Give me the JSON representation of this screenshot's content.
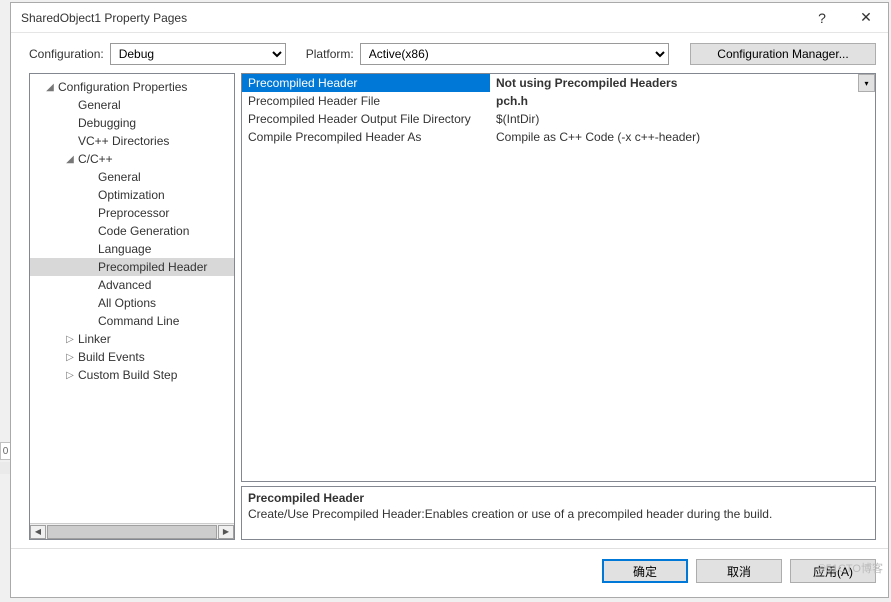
{
  "title": "SharedObject1 Property Pages",
  "toolbar": {
    "config_label": "Configuration:",
    "config_value": "Debug",
    "platform_label": "Platform:",
    "platform_value": "Active(x86)",
    "config_mgr": "Configuration Manager..."
  },
  "tree": {
    "root": "Configuration Properties",
    "items_d1_top": [
      "General",
      "Debugging",
      "VC++ Directories"
    ],
    "cxx": "C/C++",
    "items_d2": [
      "General",
      "Optimization",
      "Preprocessor",
      "Code Generation",
      "Language",
      "Precompiled Header",
      "Advanced",
      "All Options",
      "Command Line"
    ],
    "items_d1_bot": [
      "Linker",
      "Build Events",
      "Custom Build Step"
    ],
    "selected": "Precompiled Header"
  },
  "grid": [
    {
      "name": "Precompiled Header",
      "value": "Not using Precompiled Headers",
      "sel": true
    },
    {
      "name": "Precompiled Header File",
      "value": "pch.h",
      "bold": true
    },
    {
      "name": "Precompiled Header Output File Directory",
      "value": "$(IntDir)"
    },
    {
      "name": "Compile Precompiled Header As",
      "value": "Compile as C++ Code (-x c++-header)"
    }
  ],
  "desc": {
    "title": "Precompiled Header",
    "text": "Create/Use Precompiled Header:Enables creation or use of a precompiled header during the build."
  },
  "footer": {
    "ok": "确定",
    "cancel": "取消",
    "apply": "应用(A)"
  },
  "watermark": "©51CTO博客"
}
